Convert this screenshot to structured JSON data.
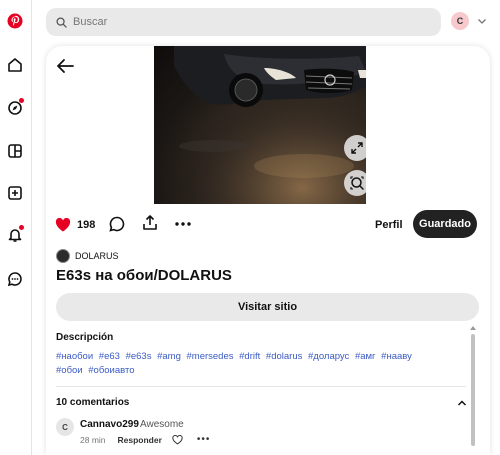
{
  "search": {
    "placeholder": "Buscar"
  },
  "account": {
    "initial": "C"
  },
  "pin": {
    "likes_count": "198",
    "profile_label": "Perfil",
    "saved_label": "Guardado",
    "owner_name": "DOLARUS",
    "title": "E63s на обои/DOLARUS",
    "visit_label": "Visitar sitio",
    "description_heading": "Descripción",
    "tags": [
      "#наобои",
      "#e63",
      "#e63s",
      "#amg",
      "#mersedes",
      "#drift",
      "#dolarus",
      "#доларус",
      "#амг",
      "#нааву",
      "#обои",
      "#обоиавто"
    ],
    "comments_heading": "10 comentarios",
    "comment": {
      "avatar_initial": "C",
      "user": "Cannavo299",
      "text": "Awesome",
      "time": "28 min",
      "reply_label": "Responder"
    }
  },
  "colors": {
    "brand": "#e60023",
    "saved_bg": "#222222",
    "tag_link": "#3b5bc4"
  },
  "icons": [
    "pinterest-logo",
    "home-icon",
    "explore-icon",
    "boards-icon",
    "create-icon",
    "notifications-icon",
    "messages-icon",
    "search-icon",
    "chevron-down-icon",
    "back-arrow-icon",
    "expand-icon",
    "visual-search-icon",
    "heart-icon",
    "comment-icon",
    "share-icon",
    "more-icon"
  ]
}
